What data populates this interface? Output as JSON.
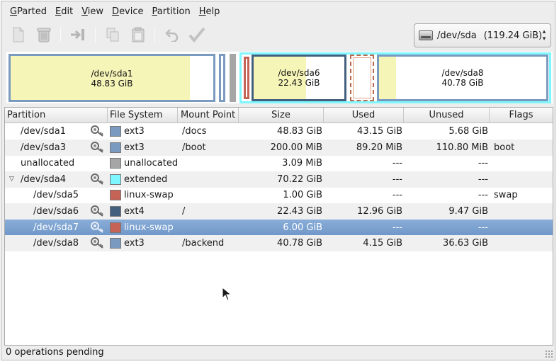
{
  "menubar": {
    "items": [
      {
        "label": "GParted",
        "ul": "G"
      },
      {
        "label": "Edit",
        "ul": "E"
      },
      {
        "label": "View",
        "ul": "V"
      },
      {
        "label": "Device",
        "ul": "D"
      },
      {
        "label": "Partition",
        "ul": "P"
      },
      {
        "label": "Help",
        "ul": "H"
      }
    ]
  },
  "toolbar": {
    "buttons": [
      {
        "name": "new-partition-button",
        "icon": "new-document-icon"
      },
      {
        "name": "delete-partition-button",
        "icon": "trash-icon"
      },
      {
        "name": "resize-move-button",
        "icon": "resize-move-icon"
      },
      {
        "name": "copy-button",
        "icon": "copy-icon"
      },
      {
        "name": "paste-button",
        "icon": "paste-icon"
      },
      {
        "name": "undo-button",
        "icon": "undo-icon"
      },
      {
        "name": "apply-button",
        "icon": "checkmark-icon"
      }
    ],
    "device": {
      "path": "/dev/sda",
      "size": "(119.24 GiB)"
    }
  },
  "partition_map": {
    "sda1": {
      "name": "/dev/sda1",
      "size": "48.83 GiB",
      "used_fraction": 0.884
    },
    "sda6": {
      "name": "/dev/sda6",
      "size": "22.43 GiB",
      "used_fraction": 0.578
    },
    "sda8": {
      "name": "/dev/sda8",
      "size": "40.78 GiB",
      "used_fraction": 0.102
    }
  },
  "columns": {
    "partition": "Partition",
    "filesystem": "File System",
    "mountpoint": "Mount Point",
    "size": "Size",
    "used": "Used",
    "unused": "Unused",
    "flags": "Flags"
  },
  "rows": [
    {
      "partition": "/dev/sda1",
      "filesystem": "ext3",
      "mountpoint": "/docs",
      "size": "48.83 GiB",
      "used": "43.15 GiB",
      "unused": "5.68 GiB",
      "flags": ""
    },
    {
      "partition": "/dev/sda3",
      "filesystem": "ext3",
      "mountpoint": "/boot",
      "size": "200.00 MiB",
      "used": "89.20 MiB",
      "unused": "110.80 MiB",
      "flags": "boot"
    },
    {
      "partition": "unallocated",
      "filesystem": "unallocated",
      "mountpoint": "",
      "size": "3.09 MiB",
      "used": "---",
      "unused": "---",
      "flags": ""
    },
    {
      "partition": "/dev/sda4",
      "filesystem": "extended",
      "mountpoint": "",
      "size": "70.22 GiB",
      "used": "---",
      "unused": "---",
      "flags": ""
    },
    {
      "partition": "/dev/sda5",
      "filesystem": "linux-swap",
      "mountpoint": "",
      "size": "1.00 GiB",
      "used": "---",
      "unused": "---",
      "flags": "swap"
    },
    {
      "partition": "/dev/sda6",
      "filesystem": "ext4",
      "mountpoint": "/",
      "size": "22.43 GiB",
      "used": "12.96 GiB",
      "unused": "9.47 GiB",
      "flags": ""
    },
    {
      "partition": "/dev/sda7",
      "filesystem": "linux-swap",
      "mountpoint": "",
      "size": "6.00 GiB",
      "used": "---",
      "unused": "---",
      "flags": ""
    },
    {
      "partition": "/dev/sda8",
      "filesystem": "ext3",
      "mountpoint": "/backend",
      "size": "40.78 GiB",
      "used": "4.15 GiB",
      "unused": "36.63 GiB",
      "flags": ""
    }
  ],
  "colors": {
    "ext3": "#7b9abf",
    "ext4": "#44607f",
    "linux-swap": "#c46356",
    "extended": "#7ff7ff",
    "unallocated": "#a6a6a6",
    "used": "#f6f5b8",
    "selection": "#7aa1d0"
  },
  "statusbar": {
    "text": "0 operations pending"
  }
}
